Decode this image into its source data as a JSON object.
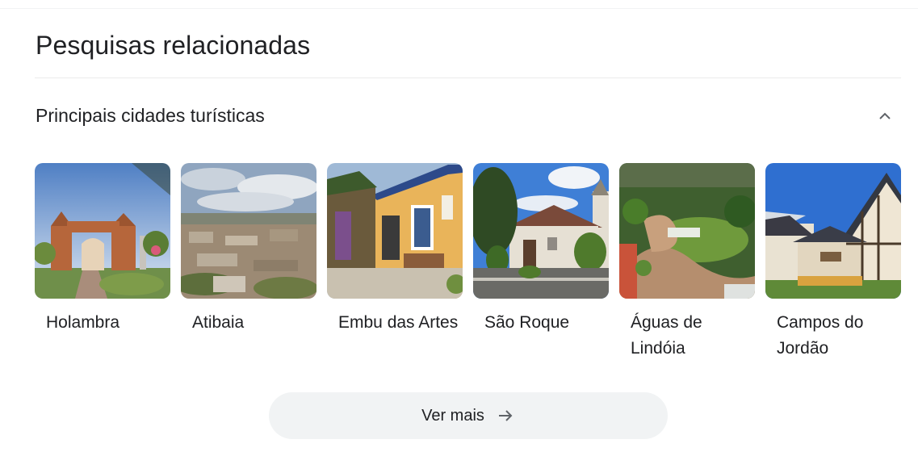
{
  "header": {
    "title": "Pesquisas relacionadas"
  },
  "section": {
    "label": "Principais cidades turísticas",
    "expand_icon": "chevron-up-icon"
  },
  "cities": [
    {
      "name": "Holambra"
    },
    {
      "name": "Atibaia"
    },
    {
      "name": "Embu das Artes"
    },
    {
      "name": "São Roque"
    },
    {
      "name": "Águas de Lindóia"
    },
    {
      "name": "Campos do Jordão"
    }
  ],
  "more_button": {
    "label": "Ver mais",
    "icon": "arrow-right-icon"
  }
}
